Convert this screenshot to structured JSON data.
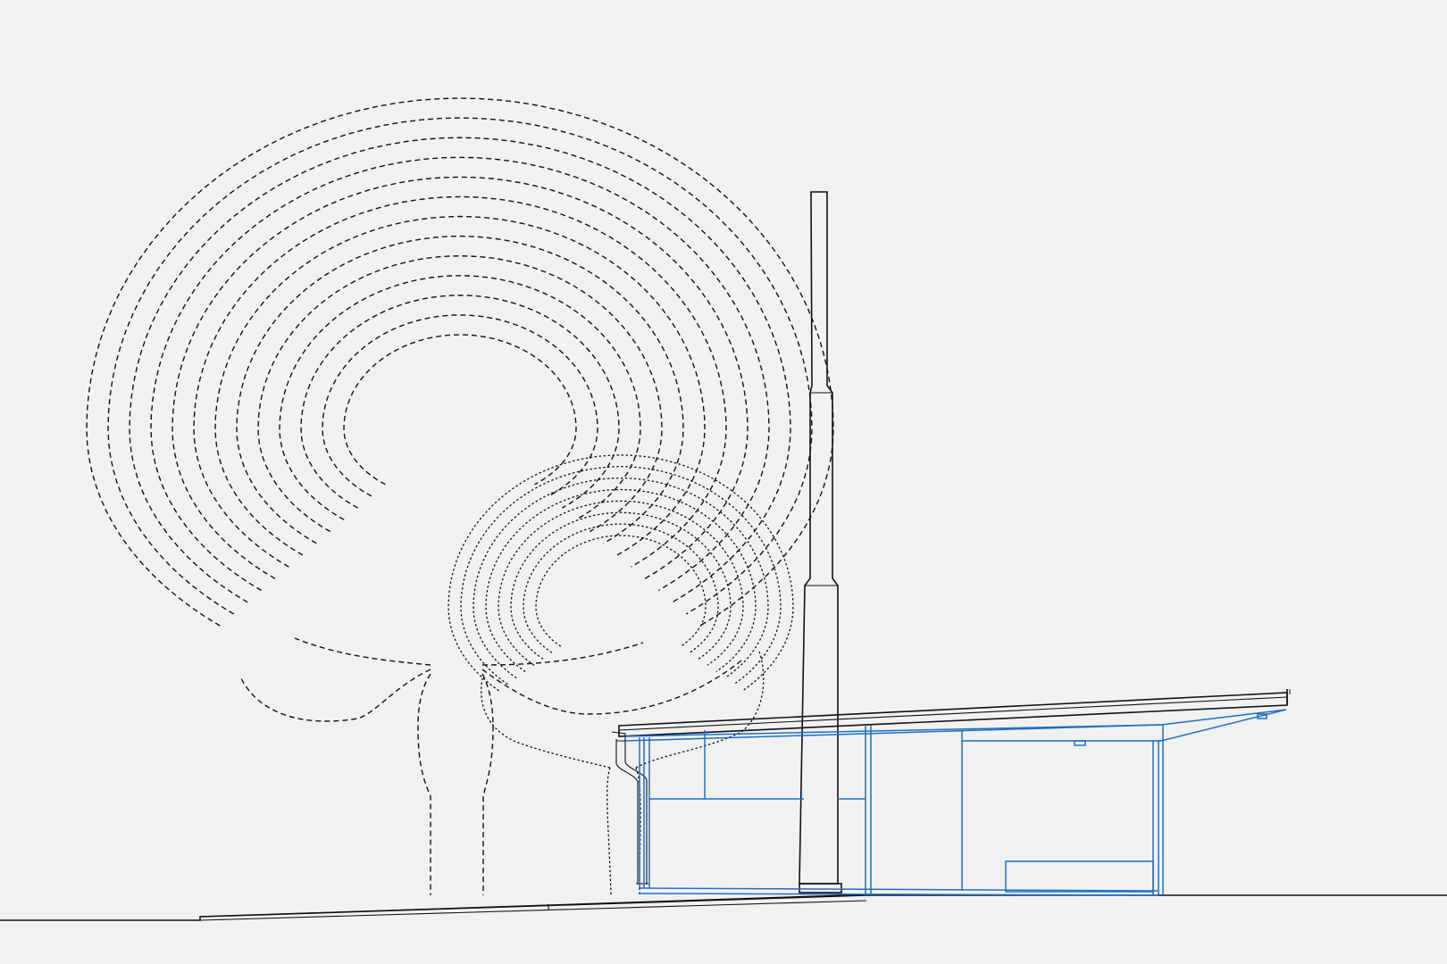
{
  "drawing": {
    "kind": "architectural section",
    "colors": {
      "background": "#f1f1f1",
      "linework": "#111111",
      "building": "#1f6fc4"
    },
    "tree_rings": {
      "large_tree": {
        "line_style": "dashed",
        "ring_count": 13
      },
      "small_tree": {
        "line_style": "dotted",
        "ring_count": 8
      }
    }
  }
}
